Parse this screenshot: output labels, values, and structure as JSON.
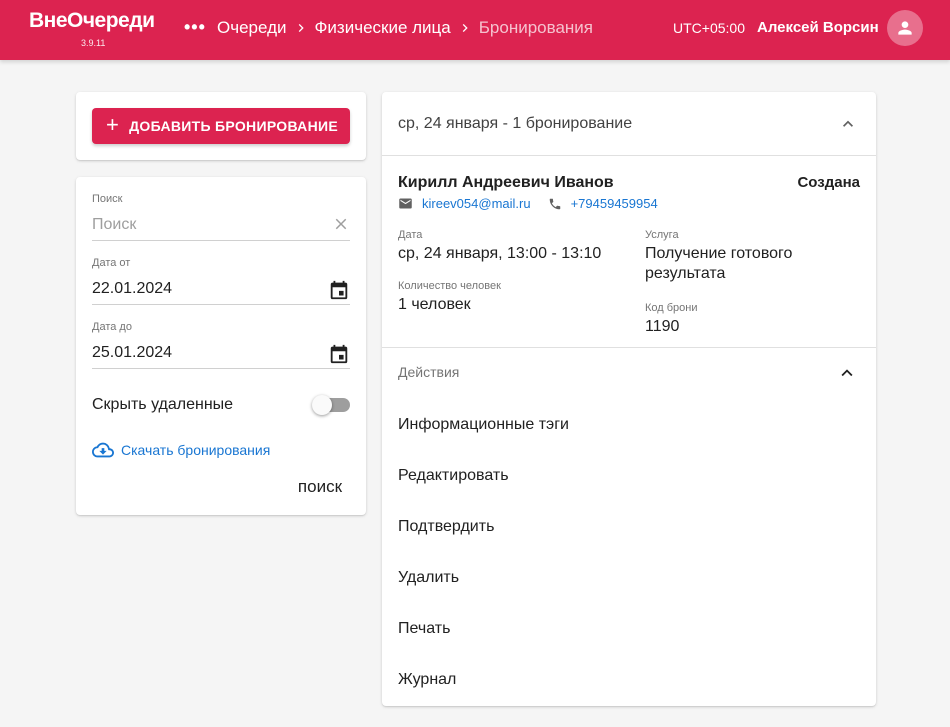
{
  "header": {
    "logo": "ВнеОчереди",
    "version": "3.9.11",
    "menu_dots": "•••",
    "breadcrumbs": [
      "Очереди",
      "Физические лица",
      "Бронирования"
    ],
    "timezone": "UTC+05:00",
    "user_name": "Алексей Ворсин",
    "brand_color": "#dc2350"
  },
  "add_button": {
    "label": "ДОБАВИТЬ БРОНИРОВАНИЕ",
    "icon": "plus-icon"
  },
  "filters": {
    "search": {
      "label": "Поиск",
      "placeholder": "Поиск",
      "value": ""
    },
    "date_from": {
      "label": "Дата от",
      "value": "22.01.2024"
    },
    "date_to": {
      "label": "Дата до",
      "value": "25.01.2024"
    },
    "hide_deleted": {
      "label": "Скрыть удаленные",
      "checked": false
    },
    "download_label": "Скачать бронирования",
    "search_button": "поиск"
  },
  "day_group": {
    "title": "ср, 24 января - 1 бронирование",
    "booking": {
      "name": "Кирилл Андреевич Иванов",
      "status": "Создана",
      "email": "kireev054@mail.ru",
      "phone": "+79459459954",
      "date_label": "Дата",
      "date_value": "ср, 24 января, 13:00 - 13:10",
      "service_label": "Услуга",
      "service_value": "Получение готового результата",
      "people_label": "Количество человек",
      "people_value": "1 человек",
      "code_label": "Код брони",
      "code_value": "1190"
    },
    "actions_title": "Действия",
    "actions": [
      "Информационные тэги",
      "Редактировать",
      "Подтвердить",
      "Удалить",
      "Печать",
      "Журнал"
    ]
  }
}
